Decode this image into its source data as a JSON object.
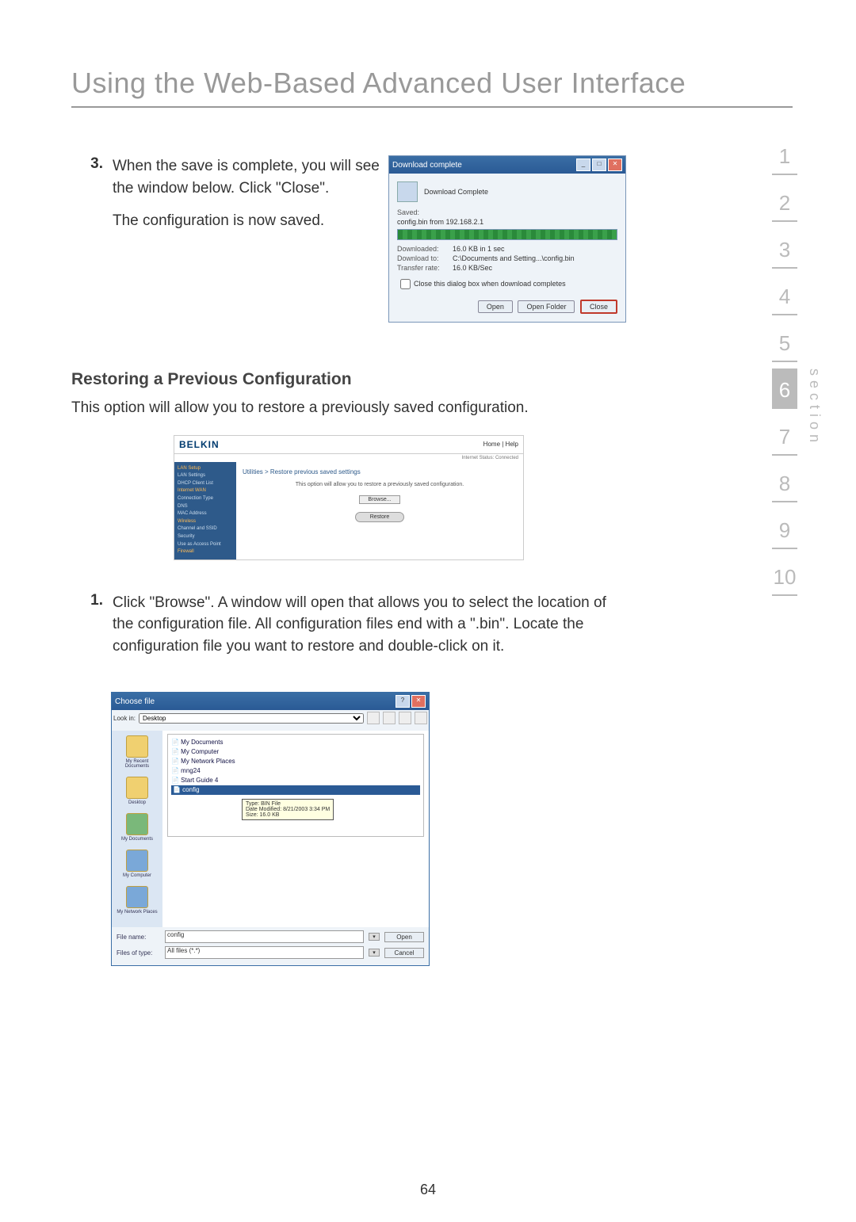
{
  "page_title": "Using the Web-Based Advanced User Interface",
  "page_number": "64",
  "section_nav": {
    "label": "section",
    "items": [
      "1",
      "2",
      "3",
      "4",
      "5",
      "6",
      "7",
      "8",
      "9",
      "10"
    ],
    "active_index": 5
  },
  "step3": {
    "number": "3.",
    "para1": "When the save is complete, you will see the window below. Click \"Close\".",
    "para2": "The configuration is now saved."
  },
  "dl_dialog": {
    "title": "Download complete",
    "header": "Download Complete",
    "saved_label": "Saved:",
    "saved_value": "config.bin from 192.168.2.1",
    "downloaded_label": "Downloaded:",
    "downloaded_value": "16.0 KB in 1 sec",
    "download_to_label": "Download to:",
    "download_to_value": "C:\\Documents and Setting...\\config.bin",
    "transfer_rate_label": "Transfer rate:",
    "transfer_rate_value": "16.0 KB/Sec",
    "checkbox": "Close this dialog box when download completes",
    "btn_open": "Open",
    "btn_open_folder": "Open Folder",
    "btn_close": "Close"
  },
  "subheading": "Restoring a Previous Configuration",
  "sub_body": "This option will allow you to restore a previously saved configuration.",
  "belkin": {
    "logo": "BELKIN",
    "home": "Home | Help",
    "status": "Internet Status: Connected",
    "side_items": [
      "LAN Setup",
      "LAN Settings",
      "DHCP Client List",
      "Internet WAN",
      "Connection Type",
      "DNS",
      "MAC Address",
      "Wireless",
      "Channel and SSID",
      "Security",
      "Use as Access Point",
      "Firewall"
    ],
    "crumb": "Utilities > Restore previous saved settings",
    "desc": "This option will allow you to restore a previously saved configuration.",
    "browse": "Browse...",
    "restore": "Restore"
  },
  "step1": {
    "number": "1.",
    "text": "Click \"Browse\". A window will open that allows you to select the location of the configuration file. All configuration files end with a \".bin\". Locate the configuration file you want to restore and double-click on it."
  },
  "choose_file": {
    "title": "Choose file",
    "lookin_label": "Look in:",
    "lookin_value": "Desktop",
    "places": [
      "My Recent Documents",
      "Desktop",
      "My Documents",
      "My Computer",
      "My Network Places"
    ],
    "list_items": [
      "My Documents",
      "My Computer",
      "My Network Places",
      "mng24",
      "Start Guide 4",
      "config"
    ],
    "selected": "config",
    "tooltip_type": "Type: BIN File",
    "tooltip_date": "Date Modified: 8/21/2003 3:34 PM",
    "tooltip_size": "Size: 16.0 KB",
    "filename_label": "File name:",
    "filename_value": "config",
    "filetype_label": "Files of type:",
    "filetype_value": "All files (*.*)",
    "btn_open": "Open",
    "btn_cancel": "Cancel"
  }
}
